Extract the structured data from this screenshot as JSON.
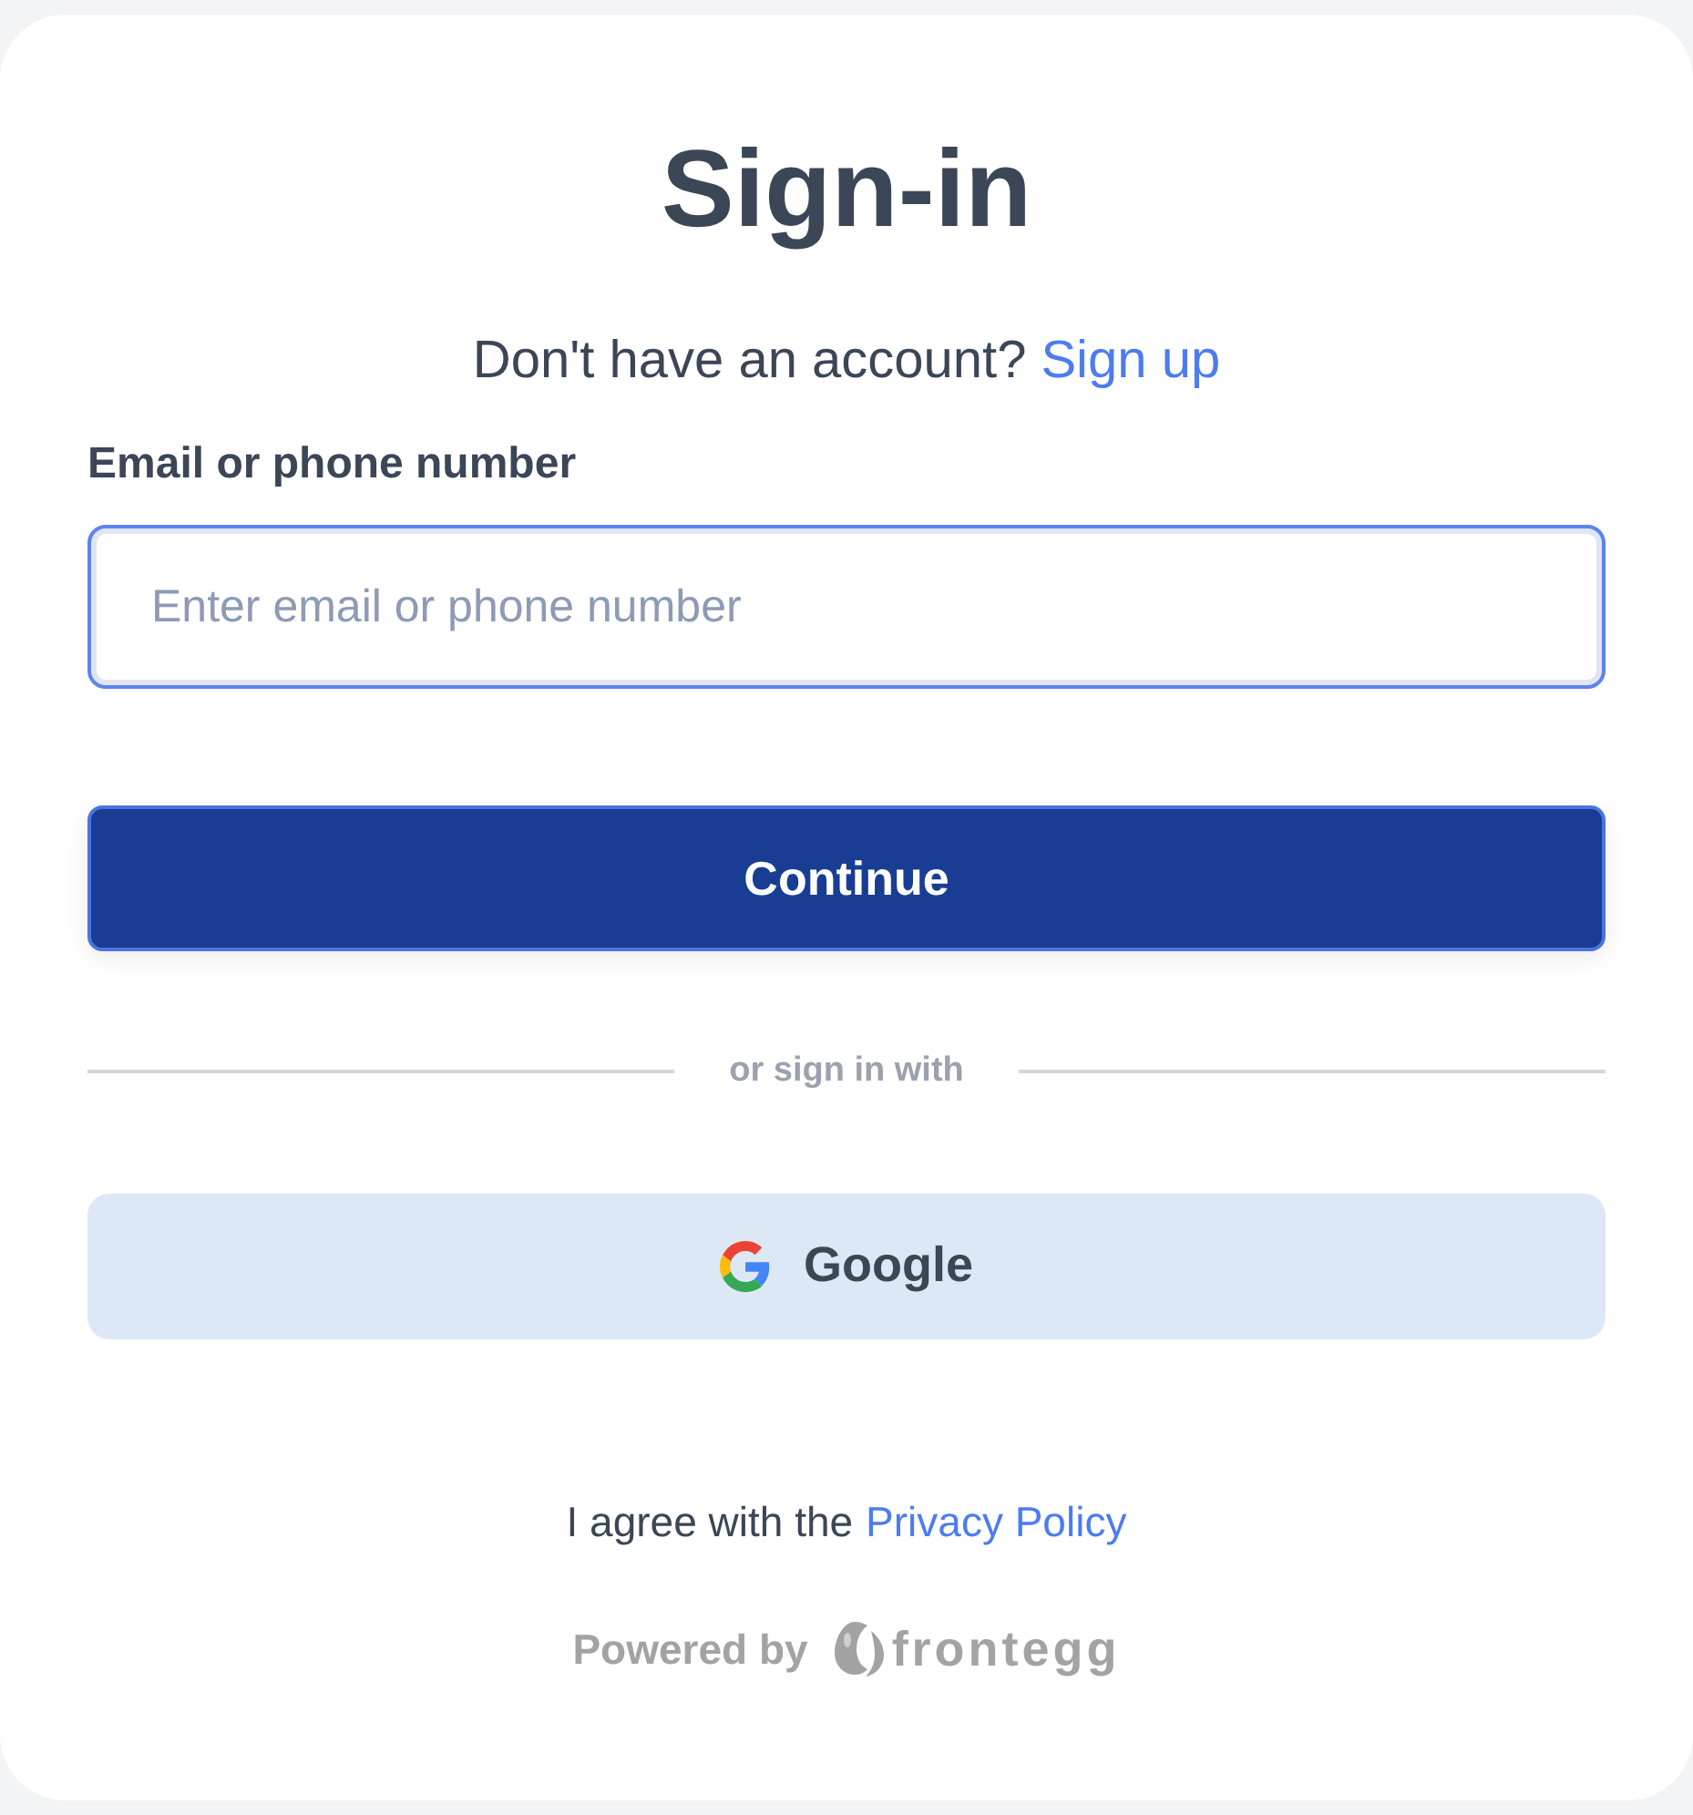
{
  "title": "Sign-in",
  "signup_prompt": {
    "text": "Don't have an account?",
    "link": "Sign up"
  },
  "email_field": {
    "label": "Email or phone number",
    "placeholder": "Enter email or phone number",
    "focused": true
  },
  "continue_button": "Continue",
  "divider": "or sign in with",
  "social_buttons": [
    {
      "kind": "google",
      "label": "Google"
    }
  ],
  "agreement": {
    "text": "I agree with the",
    "link": "Privacy Policy"
  },
  "powered_by": {
    "text": "Powered by",
    "brand": "frontegg"
  }
}
